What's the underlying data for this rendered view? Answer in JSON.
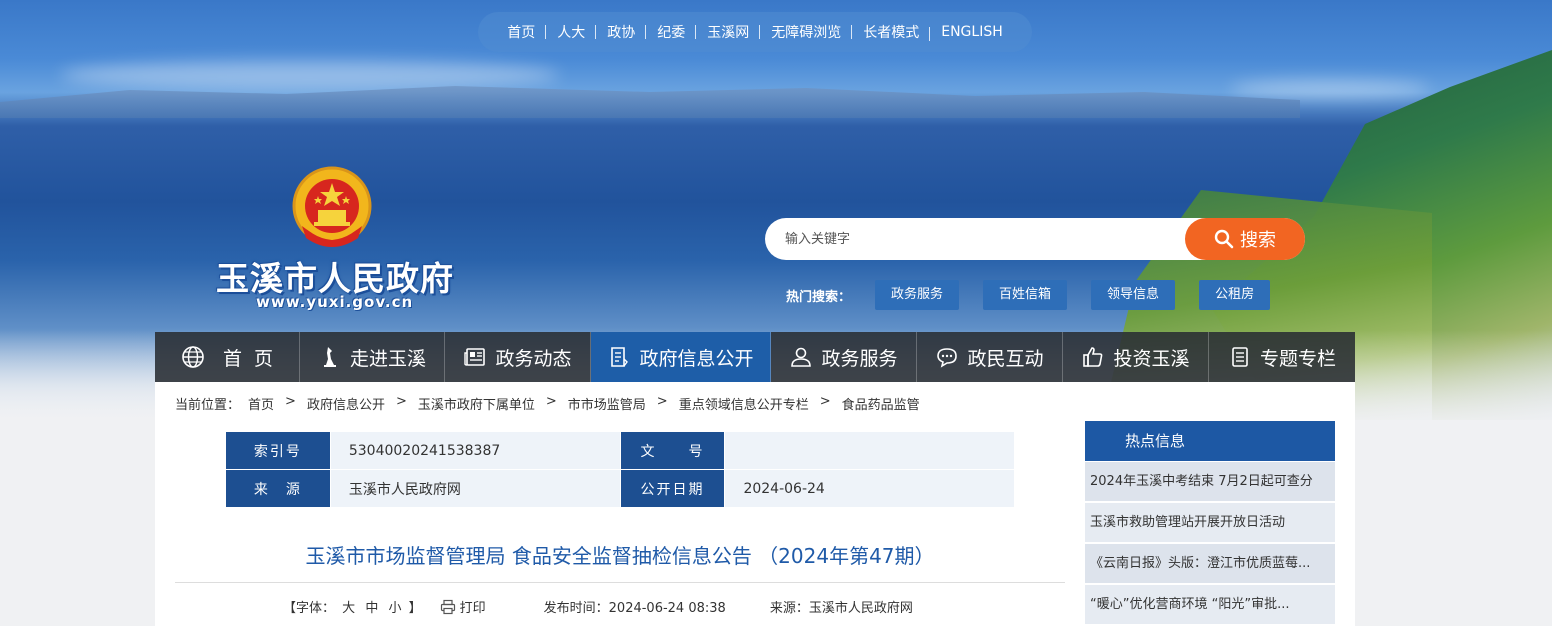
{
  "top_links": [
    "首页",
    "人大",
    "政协",
    "纪委",
    "玉溪网",
    "无障碍浏览",
    "长者模式",
    "ENGLISH"
  ],
  "site": {
    "title": "玉溪市人民政府",
    "url": "www.yuxi.gov.cn"
  },
  "search": {
    "placeholder": "输入关键字",
    "button_label": "搜索",
    "hot_label": "热门搜索：",
    "hot_tags": [
      "政务服务",
      "百姓信箱",
      "领导信息",
      "公租房"
    ]
  },
  "nav": {
    "items": [
      {
        "label": "首  页",
        "icon": "globe-icon"
      },
      {
        "label": "走进玉溪",
        "icon": "statue-icon"
      },
      {
        "label": "政务动态",
        "icon": "newspaper-icon"
      },
      {
        "label": "政府信息公开",
        "icon": "document-icon"
      },
      {
        "label": "政务服务",
        "icon": "user-icon"
      },
      {
        "label": "政民互动",
        "icon": "chat-icon"
      },
      {
        "label": "投资玉溪",
        "icon": "thumbs-up-icon"
      },
      {
        "label": "专题专栏",
        "icon": "list-icon"
      }
    ],
    "active_index": 3
  },
  "breadcrumb": {
    "label": "当前位置：",
    "items": [
      "首页",
      "政府信息公开",
      "玉溪市政府下属单位",
      "市市场监管局",
      "重点领域信息公开专栏",
      "食品药品监管"
    ]
  },
  "meta": {
    "index_label": "索引号",
    "index_value": "53040020241538387",
    "doc_no_label": "文　　号",
    "doc_no_value": "",
    "source_label": "来　源",
    "source_value": "玉溪市人民政府网",
    "date_label": "公开日期",
    "date_value": "2024-06-24"
  },
  "article": {
    "title": "玉溪市市场监督管理局 食品安全监督抽检信息公告 （2024年第47期）",
    "font_label_open": "【字体：",
    "font_large": "大",
    "font_medium": "中",
    "font_small": "小",
    "font_label_close": "】",
    "print_label": "打印",
    "pubtime": "发布时间：2024-06-24 08:38",
    "source": "来源：玉溪市人民政府网"
  },
  "sidebar": {
    "title": "热点信息",
    "items": [
      "2024年玉溪中考结束 7月2日起可查分",
      "玉溪市救助管理站开展开放日活动",
      "《云南日报》头版：澄江市优质蓝莓...",
      "“暖心”优化营商环境 “阳光”审批..."
    ]
  },
  "colors": {
    "nav_active": "#1e5ea8",
    "search_button": "#f26522",
    "meta_key_bg": "#1d4f91",
    "title_blue": "#1f5aa8"
  }
}
